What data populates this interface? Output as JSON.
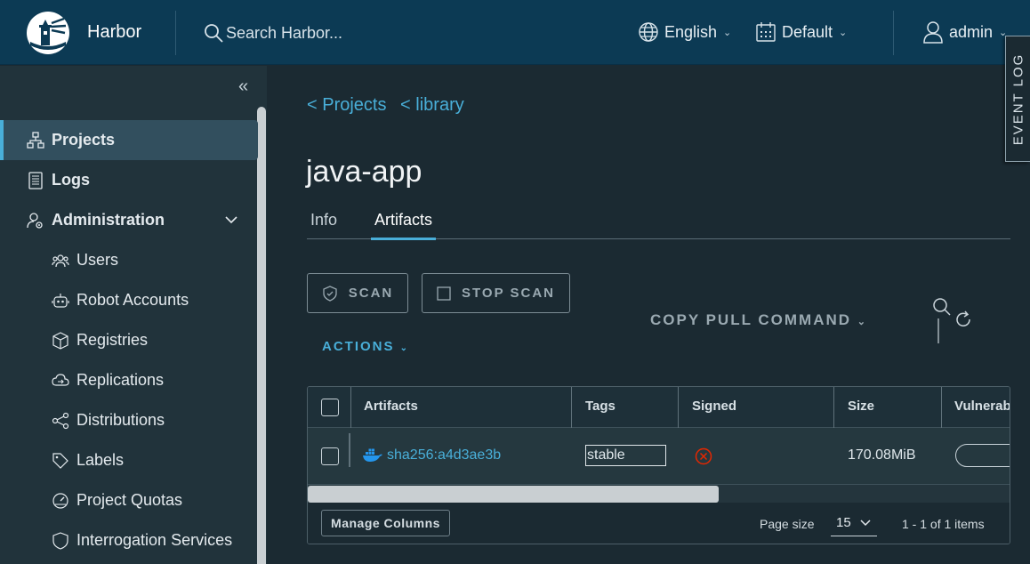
{
  "header": {
    "brand": "Harbor",
    "search_placeholder": "Search Harbor...",
    "language": "English",
    "theme": "Default",
    "user": "admin"
  },
  "event_log": "EVENT LOG",
  "sidebar": {
    "items": [
      {
        "label": "Projects",
        "icon": "projects-icon",
        "active": true
      },
      {
        "label": "Logs",
        "icon": "logs-icon"
      },
      {
        "label": "Administration",
        "icon": "administration-icon"
      },
      {
        "label": "Users",
        "icon": "users-icon"
      },
      {
        "label": "Robot Accounts",
        "icon": "robot-icon"
      },
      {
        "label": "Registries",
        "icon": "registries-icon"
      },
      {
        "label": "Replications",
        "icon": "replications-icon"
      },
      {
        "label": "Distributions",
        "icon": "distributions-icon"
      },
      {
        "label": "Labels",
        "icon": "labels-icon"
      },
      {
        "label": "Project Quotas",
        "icon": "quotas-icon"
      },
      {
        "label": "Interrogation Services",
        "icon": "interrogation-icon"
      }
    ]
  },
  "breadcrumb": {
    "projects": "< Projects",
    "library": "< library"
  },
  "page_title": "java-app",
  "tabs": [
    {
      "label": "Info"
    },
    {
      "label": "Artifacts",
      "active": true
    }
  ],
  "toolbar": {
    "scan": "SCAN",
    "stop_scan": "STOP SCAN",
    "copy_pull": "COPY PULL COMMAND",
    "actions": "ACTIONS"
  },
  "table": {
    "columns": [
      "Artifacts",
      "Tags",
      "Signed",
      "Size",
      "Vulnerab"
    ],
    "rows": [
      {
        "artifact": "sha256:a4d3ae3b",
        "tag": "stable",
        "signed": false,
        "size": "170.08MiB"
      }
    ]
  },
  "footer": {
    "manage_columns": "Manage Columns",
    "page_size_label": "Page size",
    "page_size": "15",
    "items_count": "1 - 1 of 1 items"
  },
  "colors": {
    "header_bg": "#0c3a54",
    "sidebar_bg": "#21333b",
    "main_bg": "#1b2a32",
    "accent": "#49afd9",
    "error": "#e62700"
  }
}
